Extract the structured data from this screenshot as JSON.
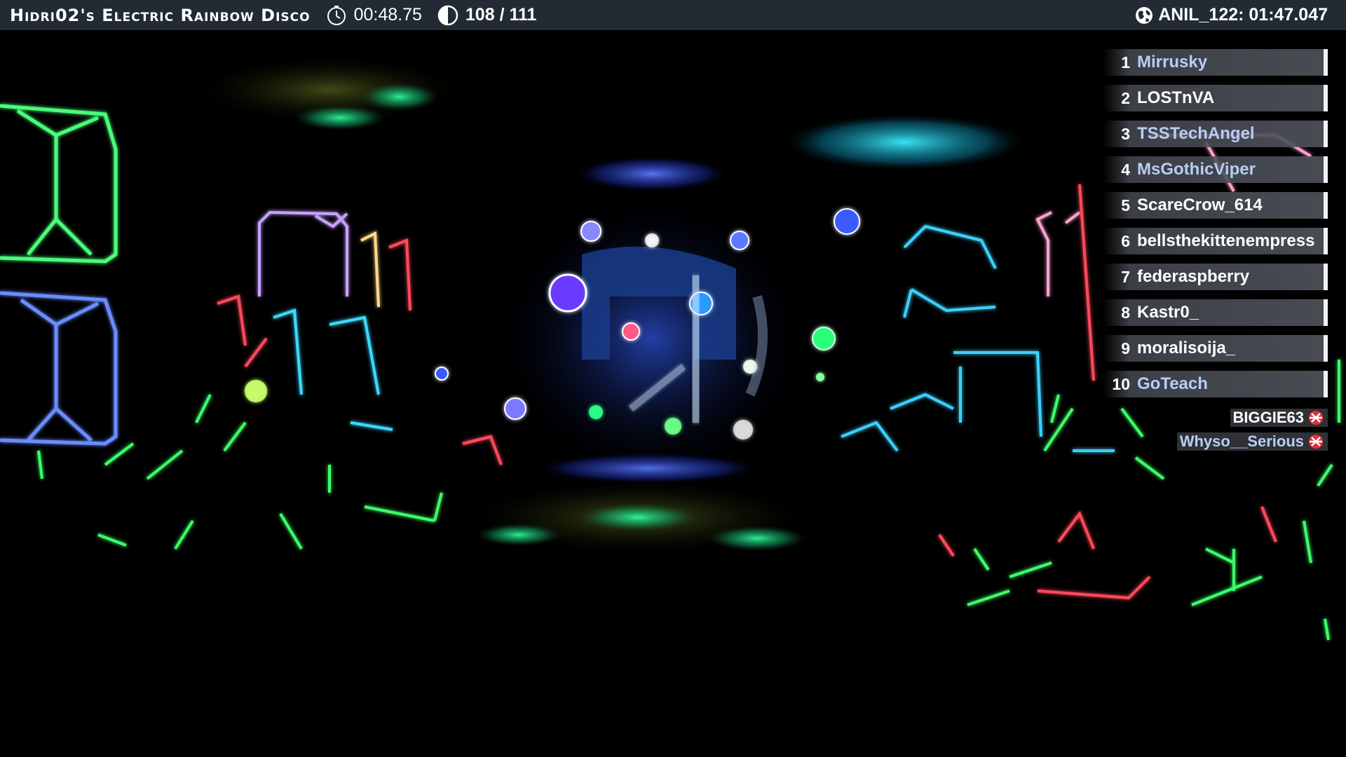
{
  "hud": {
    "level_title": "Hidri02's Electric Rainbow Disco",
    "timer": "00:48.75",
    "player_count": "108 / 111",
    "world_record": "ANIL_122: 01:47.047",
    "icons": {
      "timer": "stopwatch-icon",
      "players": "half-circle-icon",
      "record": "globe-icon"
    }
  },
  "leaderboard": {
    "entries": [
      {
        "rank": "1",
        "name": "Mirrusky",
        "color": "#b8cdf6"
      },
      {
        "rank": "2",
        "name": "LOSTnVA",
        "color": "#ffffff"
      },
      {
        "rank": "3",
        "name": "TSSTechAngel",
        "color": "#b8cdf6"
      },
      {
        "rank": "4",
        "name": "MsGothicViper",
        "color": "#b8cdf6"
      },
      {
        "rank": "5",
        "name": "ScareCrow_614",
        "color": "#ffffff"
      },
      {
        "rank": "6",
        "name": "bellsthekittenempress",
        "color": "#ffffff"
      },
      {
        "rank": "7",
        "name": "federaspberry",
        "color": "#ffffff"
      },
      {
        "rank": "8",
        "name": "Kastr0_",
        "color": "#ffffff"
      },
      {
        "rank": "9",
        "name": "moralisoija_",
        "color": "#ffffff"
      },
      {
        "rank": "10",
        "name": "GoTeach",
        "color": "#b8cdf6"
      }
    ],
    "eliminated": [
      {
        "name": "BIGGIE63",
        "icon": "eliminated-icon",
        "color": "#ffffff"
      },
      {
        "name": "Whyso__Serious",
        "icon": "eliminated-icon",
        "color": "#b8cdf6"
      }
    ]
  },
  "colors": {
    "topbar_bg": "#222a33",
    "neon_green": "#39ff6a",
    "neon_blue": "#3a6bff",
    "neon_cyan": "#3ad6ff",
    "neon_red": "#ff3a4a",
    "neon_pink": "#ff8ac8"
  }
}
